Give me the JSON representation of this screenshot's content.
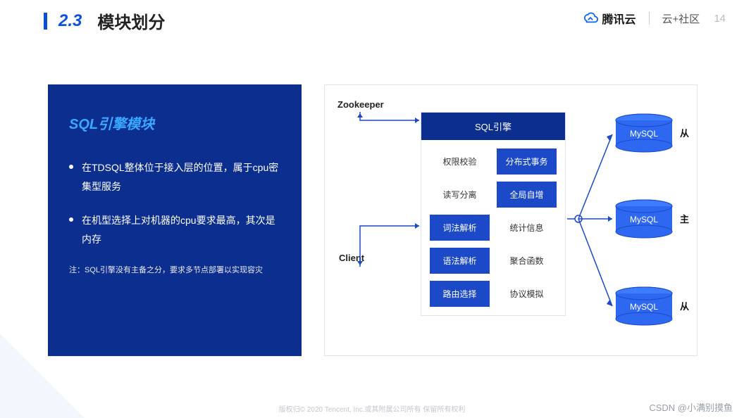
{
  "header": {
    "section_number": "2.3",
    "section_title": "模块划分",
    "brand1": "腾讯云",
    "brand2": "云+社区",
    "page": "14"
  },
  "left": {
    "title": "SQL引擎模块",
    "bullets": [
      "在TDSQL整体位于接入层的位置，属于cpu密集型服务",
      "在机型选择上对机器的cpu要求最高，其次是内存"
    ],
    "note": "注：SQL引擎没有主备之分，要求多节点部署以实现容灾"
  },
  "diagram": {
    "zookeeper_label": "Zookeeper",
    "client_label": "Client",
    "sql_head": "SQL引擎",
    "cells": [
      {
        "text": "权限校验",
        "style": "plain"
      },
      {
        "text": "分布式事务",
        "style": "blue"
      },
      {
        "text": "读写分离",
        "style": "plain"
      },
      {
        "text": "全局自增",
        "style": "blue"
      },
      {
        "text": "词法解析",
        "style": "blue"
      },
      {
        "text": "统计信息",
        "style": "plain"
      },
      {
        "text": "语法解析",
        "style": "blue"
      },
      {
        "text": "聚合函数",
        "style": "plain"
      },
      {
        "text": "路由选择",
        "style": "blue"
      },
      {
        "text": "协议模拟",
        "style": "plain"
      }
    ],
    "db": [
      {
        "name": "MySQL",
        "role": "从"
      },
      {
        "name": "MySQL",
        "role": "主"
      },
      {
        "name": "MySQL",
        "role": "从"
      }
    ]
  },
  "footer": {
    "copyright": "版权归© 2020 Tencent, Inc.或其附属公司所有 保留所有权利",
    "watermark": "CSDN @小满别摸鱼"
  }
}
